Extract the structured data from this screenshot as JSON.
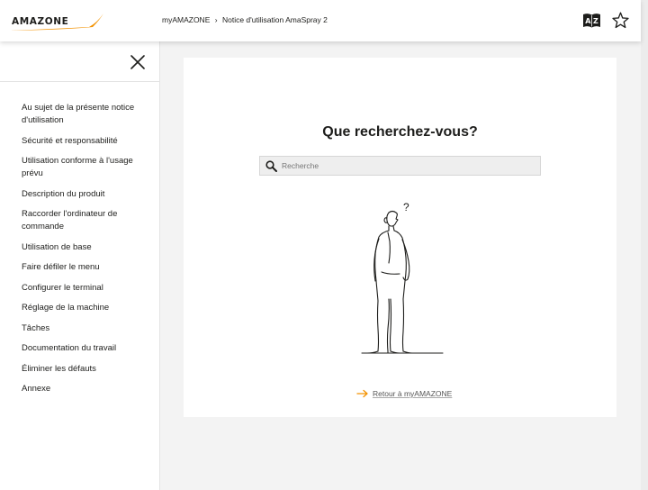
{
  "colors": {
    "brand_orange": "#f39200",
    "page_background": "#f3f3f3",
    "search_background": "#eeeeee"
  },
  "header": {
    "logo_text": "AMAZONE",
    "breadcrumb": {
      "root": "myAMAZONE",
      "separator": "›",
      "current": "Notice d'utilisation AmaSpray 2"
    },
    "icons": [
      "dictionary-icon",
      "star-icon"
    ]
  },
  "sidebar": {
    "close_icon": "close-icon",
    "items": [
      {
        "label": "Au sujet de la présente notice d'utilisation"
      },
      {
        "label": "Sécurité et responsabilité"
      },
      {
        "label": "Utilisation conforme à l'usage prévu"
      },
      {
        "label": "Description du produit"
      },
      {
        "label": "Raccorder l'ordinateur de commande"
      },
      {
        "label": "Utilisation de base"
      },
      {
        "label": "Faire défiler le menu"
      },
      {
        "label": "Configurer le terminal"
      },
      {
        "label": "Réglage de la machine"
      },
      {
        "label": "Tâches"
      },
      {
        "label": "Documentation du travail"
      },
      {
        "label": "Éliminer les défauts"
      },
      {
        "label": "Annexe"
      }
    ]
  },
  "main": {
    "title": "Que recherchez-vous?",
    "search": {
      "placeholder": "Recherche",
      "value": "",
      "icon": "search-icon"
    },
    "illustration_text": "?",
    "back_link": {
      "label": "Retour à myAMAZONE",
      "icon": "arrow-right-icon"
    }
  }
}
